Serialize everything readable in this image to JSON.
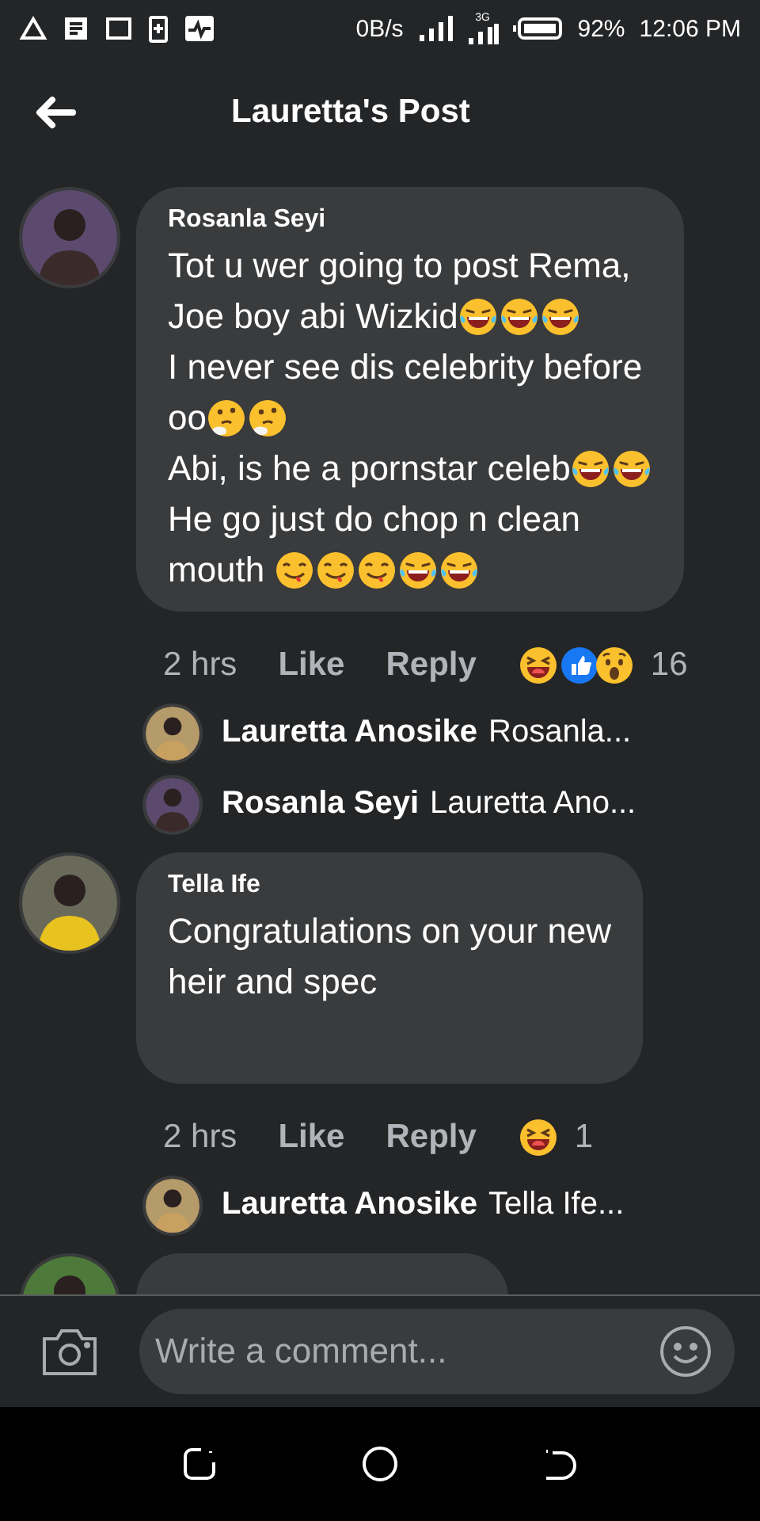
{
  "status_bar": {
    "speed": "0B/s",
    "network": "3G",
    "battery": "92%",
    "time": "12:06 PM"
  },
  "header": {
    "title": "Lauretta's Post"
  },
  "comments": [
    {
      "kind": "full",
      "name": "Rosanla Seyi",
      "lines": [
        {
          "text": "Tot u wer going to post Rema,"
        },
        {
          "text": "Joe boy abi Wizkid",
          "emojis": [
            {
              "kind": "laugh"
            },
            {
              "kind": "laugh"
            },
            {
              "kind": "laugh"
            }
          ]
        },
        {
          "text": "I never see dis celebrity before"
        },
        {
          "text": "oo",
          "emojis": [
            {
              "kind": "think"
            },
            {
              "kind": "think"
            }
          ]
        },
        {
          "text": "Abi, is he a pornstar celeb",
          "emojis": [
            {
              "kind": "laugh"
            },
            {
              "kind": "laugh"
            }
          ]
        },
        {
          "text": "He go just do chop n clean"
        },
        {
          "text": "mouth ",
          "emojis": [
            {
              "kind": "yum"
            },
            {
              "kind": "yum"
            },
            {
              "kind": "yum"
            },
            {
              "kind": "laugh"
            },
            {
              "kind": "laugh"
            }
          ]
        }
      ],
      "time": "2 hrs",
      "like": "Like",
      "reply": "Reply",
      "reactions": [
        {
          "kind": "haha"
        },
        {
          "kind": "like"
        },
        {
          "kind": "wow"
        }
      ],
      "reaction_count": "16",
      "replies": [
        {
          "name": "Lauretta Anosike",
          "text": "Rosanla..."
        },
        {
          "name": "Rosanla Seyi",
          "text": "Lauretta Ano..."
        }
      ]
    },
    {
      "kind": "full",
      "name": "Tella Ife",
      "lines": [
        {
          "text": "Congratulations on your new"
        },
        {
          "text": "heir and spec"
        }
      ],
      "time": "2 hrs",
      "like": "Like",
      "reply": "Reply",
      "reactions": [
        {
          "kind": "haha"
        }
      ],
      "reaction_count": "1",
      "replies": [
        {
          "name": "Lauretta Anosike",
          "text": "Tella Ife..."
        }
      ]
    },
    {
      "kind": "partial"
    }
  ],
  "composer": {
    "placeholder": "Write a comment..."
  }
}
